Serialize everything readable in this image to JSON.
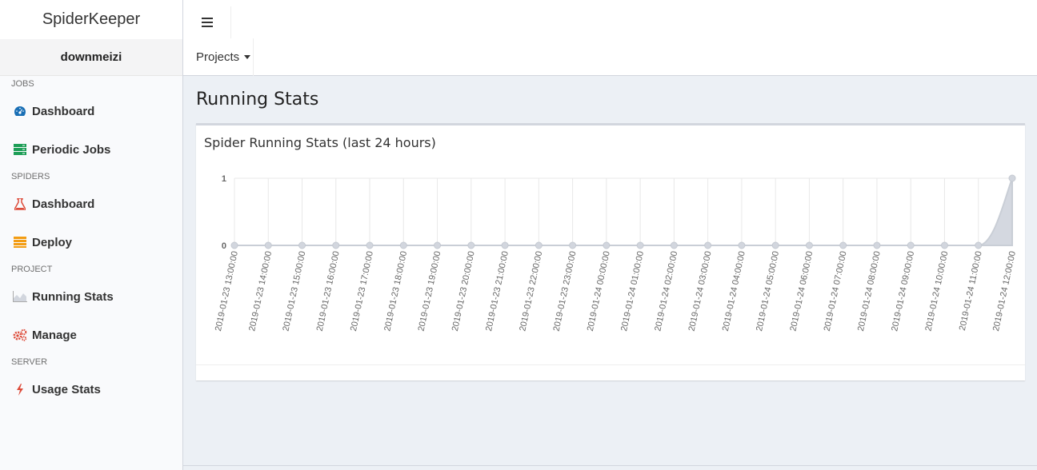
{
  "app": {
    "brand": "SpiderKeeper",
    "user": "downmeizi"
  },
  "sidebar": {
    "sections": [
      {
        "header": "JOBS",
        "items": [
          {
            "label": "Dashboard",
            "icon": "dashboard-gauge-icon",
            "color": "#1a6fb5"
          },
          {
            "label": "Periodic Jobs",
            "icon": "server-icon",
            "color": "#1e9e57"
          }
        ]
      },
      {
        "header": "SPIDERS",
        "items": [
          {
            "label": "Dashboard",
            "icon": "flask-icon",
            "color": "#dd4b39"
          },
          {
            "label": "Deploy",
            "icon": "database-stack-icon",
            "color": "#f39c12"
          }
        ]
      },
      {
        "header": "PROJECT",
        "items": [
          {
            "label": "Running Stats",
            "icon": "area-chart-icon",
            "color": "#aaaaaa"
          },
          {
            "label": "Manage",
            "icon": "gears-icon",
            "color": "#dd4b39"
          }
        ]
      },
      {
        "header": "SERVER",
        "items": [
          {
            "label": "Usage Stats",
            "icon": "bolt-icon",
            "color": "#dd4b39"
          }
        ]
      }
    ]
  },
  "navbar": {
    "toggle_icon": "hamburger-menu-icon",
    "projects_label": "Projects"
  },
  "main": {
    "page_title": "Running Stats",
    "box_title": "Spider Running Stats (last 24 hours)"
  },
  "chart_data": {
    "type": "area",
    "title": "Spider Running Stats (last 24 hours)",
    "xlabel": "",
    "ylabel": "",
    "x": [
      "2019-01-23 13:00:00",
      "2019-01-23 14:00:00",
      "2019-01-23 15:00:00",
      "2019-01-23 16:00:00",
      "2019-01-23 17:00:00",
      "2019-01-23 18:00:00",
      "2019-01-23 19:00:00",
      "2019-01-23 20:00:00",
      "2019-01-23 21:00:00",
      "2019-01-23 22:00:00",
      "2019-01-23 23:00:00",
      "2019-01-24 00:00:00",
      "2019-01-24 01:00:00",
      "2019-01-24 02:00:00",
      "2019-01-24 03:00:00",
      "2019-01-24 04:00:00",
      "2019-01-24 05:00:00",
      "2019-01-24 06:00:00",
      "2019-01-24 07:00:00",
      "2019-01-24 08:00:00",
      "2019-01-24 09:00:00",
      "2019-01-24 10:00:00",
      "2019-01-24 11:00:00",
      "2019-01-24 12:00:00"
    ],
    "values": [
      0,
      0,
      0,
      0,
      0,
      0,
      0,
      0,
      0,
      0,
      0,
      0,
      0,
      0,
      0,
      0,
      0,
      0,
      0,
      0,
      0,
      0,
      0,
      1
    ],
    "yticks": [
      "0",
      "1"
    ],
    "ylim": [
      0,
      1
    ],
    "grid": true,
    "colors": {
      "fill": "#d2d6de",
      "line": "#c9ced6",
      "point": "#d2d6de",
      "grid": "#e8e8e8"
    }
  }
}
